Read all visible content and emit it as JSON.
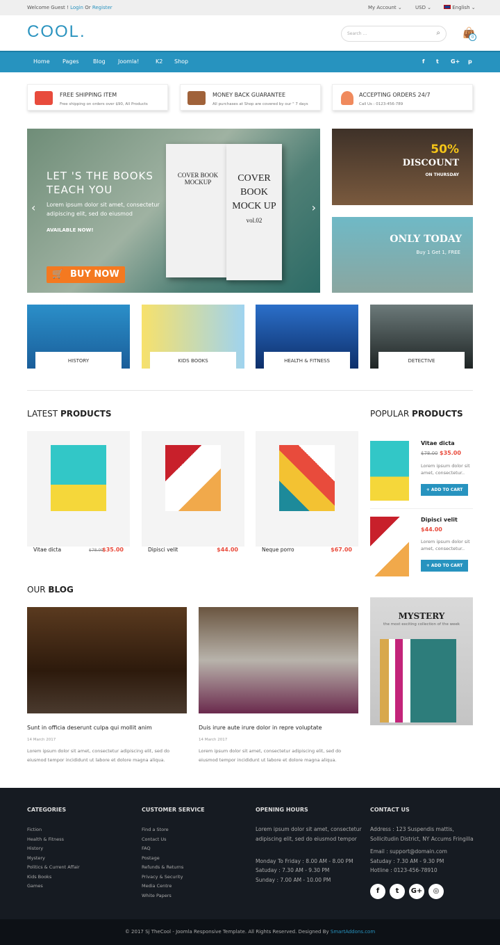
{
  "topbar": {
    "welcome": "Welcome Guest !",
    "login": "Login",
    "or": "Or",
    "register": "Register",
    "account": "My Account ⌄",
    "currency": "USD ⌄",
    "language": "English ⌄"
  },
  "header": {
    "logo": "COOL.",
    "search_placeholder": "Search ...",
    "cart_count": "0"
  },
  "nav": {
    "items": [
      "Home",
      "Pages",
      "Blog",
      "Joomla!",
      "K2",
      "Shop"
    ],
    "social": [
      "f",
      "t",
      "G+",
      "p"
    ]
  },
  "features": [
    {
      "title": "FREE SHIPPING ITEM",
      "sub": "Free shipping on orders over $90, All Products",
      "icon": "truck-icon",
      "color": "#e84b3c"
    },
    {
      "title": "MONEY BACK GUARANTEE",
      "sub": "All purchases at Shop are covered by our \" 7 days",
      "icon": "wallet-icon",
      "color": "#a0623a"
    },
    {
      "title": "ACCEPTING ORDERS 24/7",
      "sub": "Call Us : 0123-456-789",
      "icon": "support-agent-icon",
      "color": "#f08a5d"
    }
  ],
  "hero": {
    "title": "LET 'S THE BOOKS TEACH YOU",
    "text": "Lorem ipsum dolor sit amet, consectetur adipiscing elit, sed do eiusmod",
    "available": "AVAILABLE NOW!",
    "buy": "BUY NOW",
    "book1": "COVER BOOK MOCKUP",
    "book2": "COVER BOOK MOCK UP",
    "book2_vol": "vol.02"
  },
  "banners": [
    {
      "big": "50%",
      "mid": "DISCOUNT",
      "small": "ON THURSDAY"
    },
    {
      "big": "ONLY TODAY",
      "small": "Buy 1 Get 1, FREE"
    }
  ],
  "categories": [
    "HISTORY",
    "KIDS BOOKS",
    "HEALTH & FITNESS",
    "DETECTIVE"
  ],
  "latest": {
    "title_light": "LATEST",
    "title_bold": "PRODUCTS",
    "items": [
      {
        "name": "Vitae dicta",
        "old": "$78.00",
        "price": "$35.00"
      },
      {
        "name": "Dipisci velit",
        "old": "",
        "price": "$44.00"
      },
      {
        "name": "Neque porro",
        "old": "",
        "price": "$67.00"
      }
    ]
  },
  "popular": {
    "title_light": "POPULAR",
    "title_bold": "PRODUCTS",
    "items": [
      {
        "name": "Vitae dicta",
        "old": "$78.00",
        "price": "$35.00",
        "desc": "Lorem ipsum dolor sit amet, consectetur..",
        "btn": "+ ADD TO CART"
      },
      {
        "name": "Dipisci velit",
        "old": "",
        "price": "$44.00",
        "desc": "Lorem ipsum dolor sit amet, consectetur..",
        "btn": "+ ADD TO CART"
      }
    ]
  },
  "blog": {
    "title_light": "OUR",
    "title_bold": "BLOG",
    "posts": [
      {
        "title": "Sunt in officia deserunt culpa qui mollit anim",
        "date": "14 March 2017",
        "text": "Lorem ipsum dolor sit amet, consectetur adipiscing elit, sed do eiusmod tempor incididunt ut labore et dolore magna aliqua."
      },
      {
        "title": "Duis irure aute irure dolor in repre voluptate",
        "date": "14 March 2017",
        "text": "Lorem ipsum dolor sit amet, consectetur adipiscing elit, sed do eiusmod tempor incididunt ut labore et dolore magna aliqua."
      }
    ]
  },
  "mystery": {
    "title": "MYSTERY",
    "sub": "the most exciting collection of the week"
  },
  "footer": {
    "categories": {
      "title": "CATEGORIES",
      "items": [
        "Fiction",
        "Health & Fitness",
        "History",
        "Mystery",
        "Politics & Current Affair",
        "Kids Books",
        "Games"
      ]
    },
    "service": {
      "title": "CUSTOMER SERVICE",
      "items": [
        "Find a Store",
        "Contact Us",
        "FAQ",
        "Postage",
        "Refunds & Returns",
        "Privacy & Security",
        "Media Centre",
        "White Papers"
      ]
    },
    "hours": {
      "title": "OPENING HOURS",
      "text": "Lorem ipsum dolor sit amet, consectetur adipiscing elit, sed do eiusmod tempor",
      "lines": [
        "Monday To Friday : 8.00 AM - 8.00 PM",
        "Satuday : 7.30 AM - 9.30 PM",
        "Sunday : 7.00 AM - 10.00 PM"
      ]
    },
    "contact": {
      "title": "CONTACT US",
      "address": "Address : 123 Suspendis mattis, Sollicitudin District, NY Accums Fringilla",
      "lines": [
        "Email : support@domain.com",
        "Satuday : 7.30 AM - 9.30 PM",
        "Hotline : 0123-456-78910"
      ],
      "social": [
        "f",
        "t",
        "G+",
        "◎"
      ]
    },
    "copyright": "© 2017 Sj TheCool - Joomla Responsive Template. All Rights Reserved. Designed By",
    "designer": "SmartAddons.com"
  }
}
